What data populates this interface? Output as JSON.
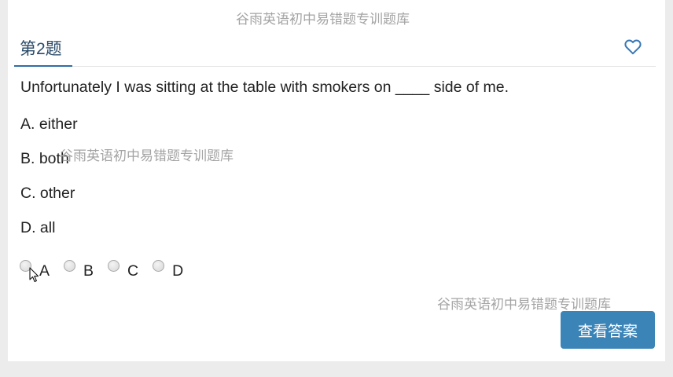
{
  "watermark": "谷雨英语初中易错题专训题库",
  "question": {
    "number_label": "第2题",
    "text": "Unfortunately I was sitting at the table with smokers on ____ side of me.",
    "options": [
      {
        "label": "A. either"
      },
      {
        "label": "B. both"
      },
      {
        "label": "C. other"
      },
      {
        "label": "D. all"
      }
    ],
    "choices": [
      {
        "letter": "A"
      },
      {
        "letter": "B"
      },
      {
        "letter": "C"
      },
      {
        "letter": "D"
      }
    ]
  },
  "actions": {
    "view_answer": "查看答案"
  },
  "icons": {
    "favorite": "heart-outline-icon",
    "cursor": "mouse-pointer-icon"
  },
  "colors": {
    "accent": "#3b84b8",
    "title": "#2b4b6a",
    "heart": "#3a78b5"
  }
}
